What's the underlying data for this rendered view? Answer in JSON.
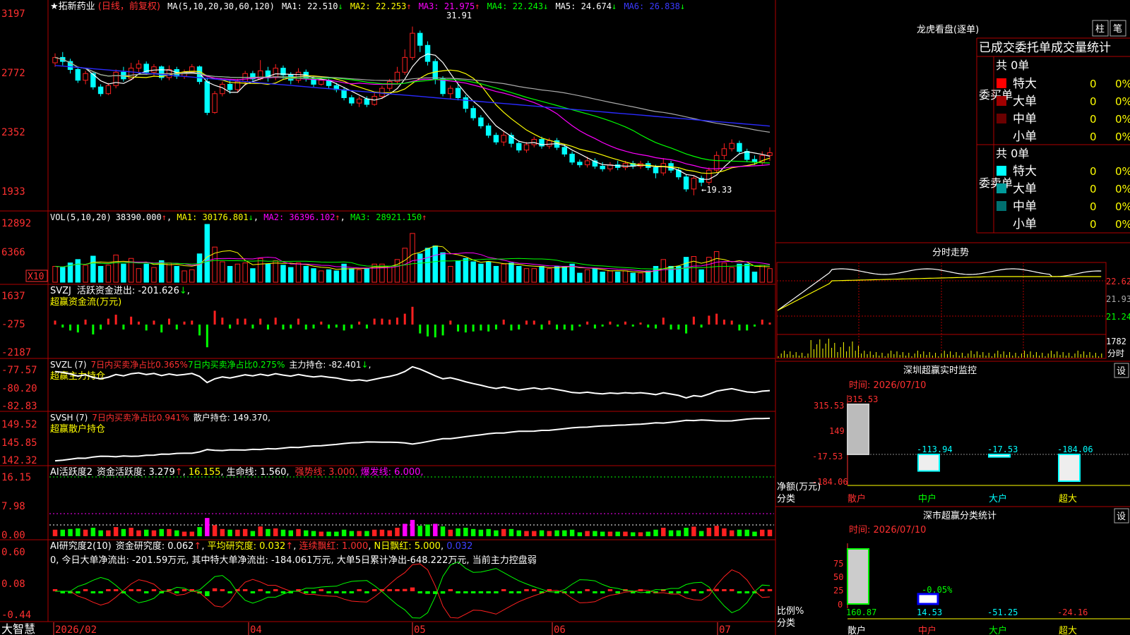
{
  "app": {
    "brand": "大智慧"
  },
  "colors": {
    "up": "#ff2020",
    "down": "#00ffff",
    "vup": "#ff2020",
    "vdown": "#00ffff",
    "grid": "#b00000",
    "white": "#ffffff",
    "yellow": "#ffff00",
    "magenta": "#ff00ff",
    "green": "#00ff00",
    "blue": "#2a2aff",
    "gray": "#aaaaaa"
  },
  "main": {
    "title": "★拓新药业",
    "mode": "(日线，前复权)",
    "ma_label": "MA(5,10,20,30,60,120)",
    "ma_values": [
      {
        "name": "MA1",
        "value": "22.510",
        "arrow": "↓"
      },
      {
        "name": "MA2",
        "value": "22.253",
        "arrow": "↑"
      },
      {
        "name": "MA3",
        "value": "21.975",
        "arrow": "↑"
      },
      {
        "name": "MA4",
        "value": "22.243",
        "arrow": "↓"
      },
      {
        "name": "MA5",
        "value": "24.674",
        "arrow": "↓"
      },
      {
        "name": "MA6",
        "value": "26.838",
        "arrow": "↓"
      }
    ],
    "y_ticks": [
      "3197",
      "2772",
      "2352",
      "1933"
    ],
    "high_label": "31.91",
    "low_label": "←19.33"
  },
  "vol": {
    "label": "VOL(5,10,20)",
    "value": "38390.000",
    "ma1": "30176.801",
    "ma2": "36396.102",
    "ma3": "28921.150",
    "y_ticks": [
      "12892",
      "6366"
    ],
    "unit": "X10"
  },
  "svzj": {
    "label": "SVZJ",
    "text1": "活跃资金进出: -201.626",
    "text2": "超赢资金流(万元)",
    "y_ticks": [
      "1637",
      "-275",
      "-2187"
    ]
  },
  "svzl": {
    "label": "SVZL (7)",
    "t1": "7日内买卖净占比0.365%",
    "t2": "7日内买卖净占比0.275%",
    "t3": "主力持仓: -82.401",
    "t4": "超赢主力持仓",
    "y_ticks": [
      "-77.57",
      "-80.20",
      "-82.83"
    ]
  },
  "svsh": {
    "label": "SVSH (7)",
    "t1": "7日内买卖净占比0.941%",
    "t2": "散户持仓: 149.370",
    "t3": "超赢散户持仓",
    "y_ticks": [
      "149.52",
      "145.85",
      "142.32"
    ]
  },
  "ai1": {
    "label": "AI活跃度2",
    "t1": "资金活跃度: 3.279",
    "t2": "16.155",
    "t3": "生命线: 1.560",
    "t4": "强势线: 3.000",
    "t5": "爆发线: 6.000",
    "y_ticks": [
      "16.15",
      "7.98",
      "0.00"
    ]
  },
  "ai2": {
    "label": "AI研究度2(10)",
    "t1": "资金研究度: 0.062",
    "t2": "平均研究度: 0.032",
    "t3": "连续飘红: 1.000",
    "t4": "N日飘红: 5.000",
    "t5": "0.032",
    "note": "0, 今日大单净流出: -201.59万元, 其中特大单净流出: -184.061万元, 大单5日累计净出-648.222万元, 当前主力控盘弱",
    "y_ticks": [
      "0.60",
      "0.08",
      "-0.44"
    ]
  },
  "x_axis": [
    "2026/02",
    "04",
    "05",
    "06",
    "07"
  ],
  "dragon": {
    "title": "龙虎看盘(逐单)",
    "btn1": "柱",
    "btn2": "笔",
    "subtitle": "已成交委托单成交量统计",
    "buy_label": "委买单",
    "sell_label": "委卖单",
    "buy_total": "共 0单",
    "sell_total": "共 0单",
    "buy_rows": [
      {
        "name": "特大",
        "count": "0",
        "pct": "0%",
        "color": "#ff0000"
      },
      {
        "name": "大单",
        "count": "0",
        "pct": "0%",
        "color": "#a00000"
      },
      {
        "name": "中单",
        "count": "0",
        "pct": "0%",
        "color": "#6a0000"
      },
      {
        "name": "小单",
        "count": "0",
        "pct": "0%",
        "color": "#000000"
      }
    ],
    "sell_rows": [
      {
        "name": "特大",
        "count": "0",
        "pct": "0%",
        "color": "#00ffff"
      },
      {
        "name": "大单",
        "count": "0",
        "pct": "0%",
        "color": "#009a9a"
      },
      {
        "name": "中单",
        "count": "0",
        "pct": "0%",
        "color": "#007070"
      },
      {
        "name": "小单",
        "count": "0",
        "pct": "0%",
        "color": "#000000"
      }
    ]
  },
  "intraday": {
    "title": "分时走势",
    "y_ticks": [
      "22.62",
      "21.93",
      "21.24"
    ],
    "vol_tick": "1782",
    "vol_unit": "分时"
  },
  "sz_monitor": {
    "title": "深圳超赢实时监控",
    "btn": "设",
    "time": "时间: 2026/07/10",
    "y_ticks": [
      "315.53",
      "149",
      "-17.53",
      "-184.06"
    ],
    "y_label": "净额(万元)",
    "x_label": "分类",
    "categories": [
      "散户",
      "中户",
      "大户",
      "超大"
    ],
    "values": [
      315.53,
      -113.94,
      -17.53,
      -184.06
    ],
    "value_labels": [
      "315.53",
      "-113.94",
      "-17.53",
      "-184.06"
    ]
  },
  "sz_class": {
    "title": "深市超赢分类统计",
    "btn": "设",
    "time": "时间: 2026/07/10",
    "y_ticks": [
      "75",
      "50",
      "25",
      "0"
    ],
    "y_label": "比例%",
    "x_label": "分类",
    "categories": [
      "散户",
      "中户",
      "大户",
      "超大"
    ],
    "values": [
      160.87,
      14.53,
      -51.25,
      -24.16
    ],
    "value_labels": [
      "160.87",
      "14.53",
      "-51.25",
      "-24.16"
    ],
    "mid_note": "-0.05%"
  },
  "chart_data": {
    "type": "candlestick",
    "title": "★拓新药业",
    "x_labels": [
      "2026/02",
      "04",
      "05",
      "06",
      "07"
    ],
    "y_ticks": [
      3197,
      2772,
      2352,
      1933
    ],
    "high": 31.91,
    "low": 19.33,
    "candles": [
      [
        29.2,
        29.6,
        29.9,
        28.9
      ],
      [
        29.6,
        29.3,
        30.0,
        29.0
      ],
      [
        29.3,
        28.7,
        29.5,
        28.4
      ],
      [
        28.7,
        27.9,
        28.9,
        27.7
      ],
      [
        27.9,
        28.4,
        28.6,
        27.6
      ],
      [
        28.4,
        27.4,
        28.5,
        27.2
      ],
      [
        27.4,
        26.9,
        27.6,
        26.7
      ],
      [
        26.9,
        27.5,
        27.7,
        26.8
      ],
      [
        27.5,
        28.5,
        28.7,
        27.3
      ],
      [
        28.5,
        28.0,
        28.9,
        27.8
      ],
      [
        28.0,
        28.8,
        29.2,
        27.9
      ],
      [
        28.8,
        29.1,
        29.4,
        28.5
      ],
      [
        29.1,
        28.5,
        29.3,
        28.3
      ],
      [
        28.5,
        28.9,
        29.1,
        28.2
      ],
      [
        28.9,
        28.1,
        29.0,
        27.9
      ],
      [
        28.1,
        28.7,
        29.0,
        27.9
      ],
      [
        28.7,
        28.2,
        28.9,
        28.0
      ],
      [
        28.2,
        28.5,
        28.7,
        28.0
      ],
      [
        28.5,
        28.9,
        29.1,
        28.4
      ],
      [
        28.9,
        27.8,
        29.0,
        27.6
      ],
      [
        27.8,
        25.5,
        28.1,
        25.3
      ],
      [
        25.5,
        26.9,
        27.1,
        25.4
      ],
      [
        26.9,
        27.6,
        27.8,
        26.7
      ],
      [
        27.6,
        27.2,
        27.9,
        26.9
      ],
      [
        27.2,
        27.8,
        28.0,
        27.0
      ],
      [
        27.8,
        28.4,
        28.6,
        27.5
      ],
      [
        28.4,
        28.0,
        28.6,
        27.8
      ],
      [
        28.0,
        28.6,
        29.4,
        27.9
      ],
      [
        28.6,
        28.1,
        28.9,
        27.8
      ],
      [
        28.1,
        28.8,
        29.1,
        27.9
      ],
      [
        28.8,
        28.3,
        29.0,
        28.0
      ],
      [
        28.3,
        27.9,
        28.5,
        27.6
      ],
      [
        27.9,
        28.5,
        28.8,
        27.7
      ],
      [
        28.5,
        28.0,
        28.7,
        27.8
      ],
      [
        28.0,
        27.6,
        28.2,
        27.4
      ],
      [
        27.6,
        27.9,
        28.2,
        27.5
      ],
      [
        27.9,
        27.5,
        28.0,
        27.3
      ],
      [
        27.5,
        27.2,
        27.7,
        27.0
      ],
      [
        27.2,
        26.6,
        27.4,
        26.4
      ],
      [
        26.6,
        26.2,
        26.8,
        26.0
      ],
      [
        26.2,
        26.5,
        26.7,
        25.9
      ],
      [
        26.5,
        26.1,
        26.7,
        25.9
      ],
      [
        26.1,
        26.7,
        27.0,
        26.0
      ],
      [
        26.7,
        27.3,
        27.5,
        26.5
      ],
      [
        27.3,
        27.8,
        28.0,
        27.1
      ],
      [
        27.8,
        28.5,
        28.9,
        27.6
      ],
      [
        28.5,
        29.6,
        30.2,
        28.3
      ],
      [
        29.6,
        31.4,
        31.9,
        29.4
      ],
      [
        31.4,
        30.5,
        31.6,
        30.0
      ],
      [
        30.5,
        29.3,
        30.8,
        29.0
      ],
      [
        29.3,
        28.0,
        29.5,
        27.6
      ],
      [
        28.0,
        26.9,
        28.2,
        26.7
      ],
      [
        26.9,
        27.3,
        27.5,
        26.5
      ],
      [
        27.3,
        26.6,
        27.6,
        26.4
      ],
      [
        26.6,
        25.8,
        26.8,
        25.5
      ],
      [
        25.8,
        25.1,
        26.0,
        24.9
      ],
      [
        25.1,
        24.5,
        25.3,
        24.3
      ],
      [
        24.5,
        23.8,
        24.7,
        23.6
      ],
      [
        23.8,
        23.3,
        24.0,
        23.1
      ],
      [
        23.3,
        23.8,
        24.1,
        23.0
      ],
      [
        23.8,
        23.2,
        24.0,
        22.9
      ],
      [
        23.2,
        22.7,
        23.4,
        22.5
      ],
      [
        22.7,
        23.1,
        23.3,
        22.5
      ],
      [
        23.1,
        23.5,
        23.7,
        22.9
      ],
      [
        23.5,
        23.0,
        23.7,
        22.8
      ],
      [
        23.0,
        23.4,
        23.6,
        22.8
      ],
      [
        23.4,
        22.9,
        23.6,
        22.7
      ],
      [
        22.9,
        22.4,
        23.1,
        22.2
      ],
      [
        22.4,
        21.8,
        22.6,
        21.6
      ],
      [
        21.8,
        21.6,
        22.0,
        21.4
      ],
      [
        21.6,
        21.9,
        22.2,
        21.4
      ],
      [
        21.9,
        21.5,
        22.1,
        21.3
      ],
      [
        21.5,
        21.3,
        21.8,
        21.1
      ],
      [
        21.3,
        21.6,
        21.8,
        21.1
      ],
      [
        21.6,
        21.4,
        21.9,
        21.2
      ],
      [
        21.4,
        21.7,
        21.9,
        21.2
      ],
      [
        21.7,
        21.5,
        21.9,
        21.3
      ],
      [
        21.5,
        21.7,
        21.9,
        21.3
      ],
      [
        21.7,
        21.4,
        21.9,
        21.2
      ],
      [
        21.4,
        21.0,
        21.6,
        20.6
      ],
      [
        21.0,
        21.7,
        22.1,
        20.8
      ],
      [
        21.7,
        21.2,
        21.9,
        21.0
      ],
      [
        21.2,
        20.7,
        21.4,
        20.5
      ],
      [
        20.7,
        19.8,
        20.9,
        19.6
      ],
      [
        19.8,
        20.6,
        20.8,
        19.33
      ],
      [
        20.6,
        20.3,
        20.8,
        20.0
      ],
      [
        20.3,
        21.2,
        21.4,
        20.1
      ],
      [
        21.2,
        22.3,
        22.6,
        21.0
      ],
      [
        22.3,
        22.8,
        23.2,
        22.0
      ],
      [
        22.8,
        23.2,
        23.5,
        22.6
      ],
      [
        23.2,
        22.6,
        23.4,
        22.4
      ],
      [
        22.6,
        22.0,
        22.8,
        21.8
      ],
      [
        22.0,
        21.8,
        22.3,
        21.6
      ],
      [
        21.8,
        22.3,
        22.6,
        21.6
      ],
      [
        22.3,
        22.5,
        22.9,
        21.9
      ]
    ],
    "ma_values": {
      "MA1": 22.51,
      "MA2": 22.253,
      "MA3": 21.975,
      "MA4": 22.243,
      "MA5": 24.674,
      "MA6": 26.838
    },
    "volume": {
      "last": 38390.0,
      "MA1": 30176.801,
      "MA2": 36396.102,
      "MA3": 28921.15,
      "y_ticks": [
        12892,
        6366
      ]
    },
    "svzj": {
      "last": -201.626,
      "y_ticks": [
        1637,
        -275,
        -2187
      ]
    },
    "svzl": {
      "last": -82.401,
      "y_ticks": [
        -77.57,
        -80.2,
        -82.83
      ]
    },
    "svsh": {
      "last": 149.37,
      "y_ticks": [
        149.52,
        145.85,
        142.32
      ]
    },
    "ai_active": {
      "last": 3.279,
      "max": 16.155,
      "life": 1.56,
      "strong": 3.0,
      "burst": 6.0,
      "y_ticks": [
        16.15,
        7.98,
        0.0
      ]
    },
    "ai_research": {
      "last": 0.062,
      "avg": 0.032,
      "y_ticks": [
        0.6,
        0.08,
        -0.44
      ]
    },
    "sz_monitor": {
      "categories": [
        "散户",
        "中户",
        "大户",
        "超大"
      ],
      "values": [
        315.53,
        -113.94,
        -17.53,
        -184.06
      ]
    },
    "sz_class": {
      "categories": [
        "散户",
        "中户",
        "大户",
        "超大"
      ],
      "values": [
        160.87,
        14.53,
        -51.25,
        -24.16
      ]
    }
  }
}
